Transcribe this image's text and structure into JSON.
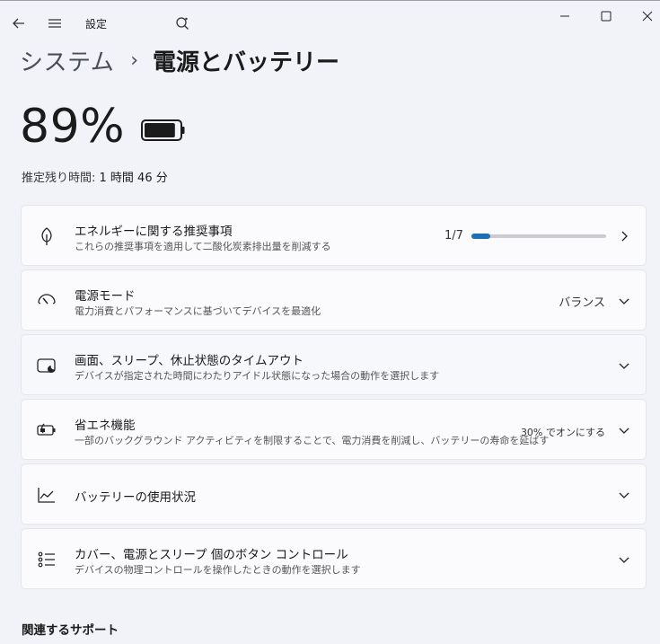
{
  "titlebar": {
    "title": "設定",
    "icons": {
      "back": "back-arrow-icon",
      "menu": "hamburger-menu-icon",
      "search": "search-icon"
    },
    "controls": {
      "minimize": "minimize-icon",
      "maximize": "maximize-icon",
      "close": "close-icon"
    }
  },
  "breadcrumb": {
    "parent": "システム",
    "separator": "›",
    "current": "電源とバッテリー"
  },
  "battery": {
    "percent_label": "89%",
    "level": 0.89,
    "estimate_label": "推定残り時間: ",
    "estimate_value": "1 時間 46 分"
  },
  "cards": [
    {
      "id": "energy",
      "icon": "leaf-icon",
      "title": "エネルギーに関する推奨事項",
      "subtitle": "これらの推奨事項を適用して二酸化炭素排出量を削減する",
      "progress_label": "1/7",
      "progress_fraction": 0.142857,
      "chevron": "chevron-right-icon"
    },
    {
      "id": "power-mode",
      "icon": "gauge-icon",
      "title": "電源モード",
      "subtitle": "電力消費とパフォーマンスに基づいてデバイスを最適化",
      "value": "バランス",
      "chevron": "chevron-down-icon"
    },
    {
      "id": "screen-sleep",
      "icon": "screen-sleep-icon",
      "title": "画面、スリープ、休止状態のタイムアウト",
      "subtitle": "デバイスが指定された時間にわたりアイドル状態になった場合の動作を選択します",
      "chevron": "chevron-down-icon"
    },
    {
      "id": "energy-saver",
      "icon": "battery-saver-icon",
      "title": "省エネ機能",
      "subtitle": "一部のバックグラウンド アクティビティを制限することで、電力消費を削減し、バッテリーの寿命を延ばす",
      "value": "30% でオンにする",
      "chevron": "chevron-down-icon"
    },
    {
      "id": "battery-usage",
      "icon": "line-chart-icon",
      "title": "バッテリーの使用状況",
      "chevron": "chevron-down-icon"
    },
    {
      "id": "buttons",
      "icon": "list-controls-icon",
      "title": "カバー、電源とスリープ 個のボタン コントロール",
      "subtitle": "デバイスの物理コントロールを操作したときの動作を選択します",
      "chevron": "chevron-down-icon"
    }
  ],
  "support": {
    "title": "関連するサポート"
  }
}
